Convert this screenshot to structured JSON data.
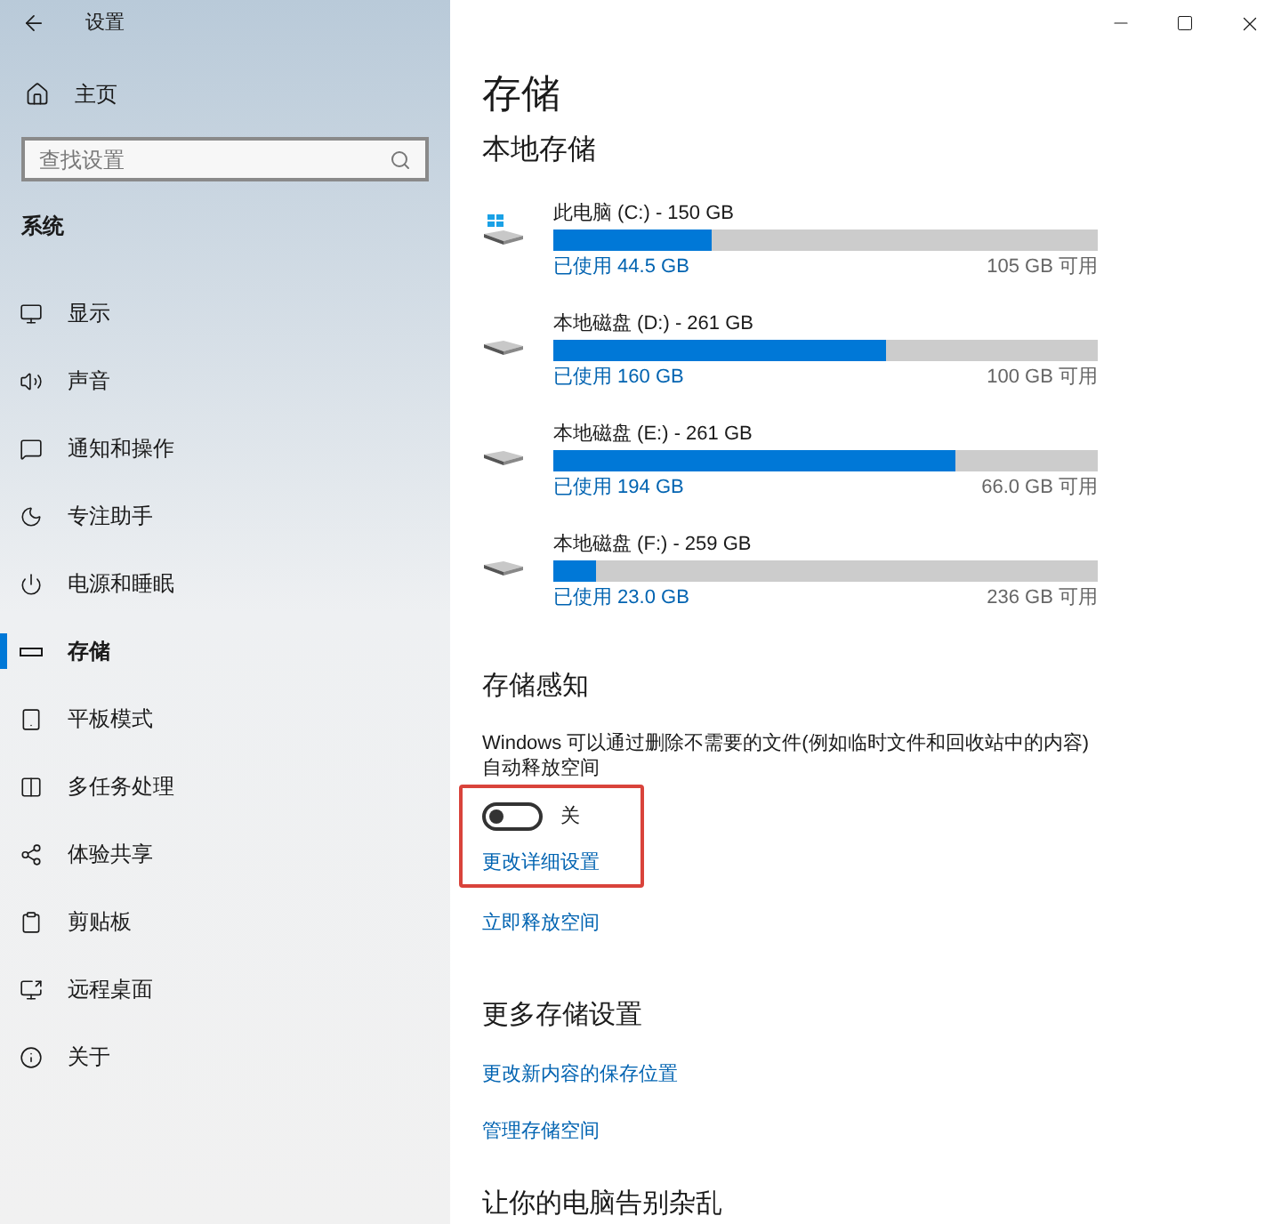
{
  "window": {
    "title": "设置"
  },
  "sidebar": {
    "home": "主页",
    "search": {
      "placeholder": "查找设置"
    },
    "section": "系统",
    "items": [
      {
        "label": "显示",
        "selected": false
      },
      {
        "label": "声音",
        "selected": false
      },
      {
        "label": "通知和操作",
        "selected": false
      },
      {
        "label": "专注助手",
        "selected": false
      },
      {
        "label": "电源和睡眠",
        "selected": false
      },
      {
        "label": "存储",
        "selected": true
      },
      {
        "label": "平板模式",
        "selected": false
      },
      {
        "label": "多任务处理",
        "selected": false
      },
      {
        "label": "体验共享",
        "selected": false
      },
      {
        "label": "剪贴板",
        "selected": false
      },
      {
        "label": "远程桌面",
        "selected": false
      },
      {
        "label": "关于",
        "selected": false
      }
    ]
  },
  "page": {
    "title": "存储",
    "local_storage": {
      "heading": "本地存储",
      "drives": [
        {
          "kind": "system",
          "name": "此电脑 (C:) - 150 GB",
          "used": "已使用 44.5 GB",
          "free": "105 GB 可用",
          "level": 0.29
        },
        {
          "kind": "disk",
          "name": "本地磁盘 (D:) - 261 GB",
          "used": "已使用 160 GB",
          "free": "100 GB 可用",
          "level": 0.61
        },
        {
          "kind": "disk",
          "name": "本地磁盘 (E:) - 261 GB",
          "used": "已使用 194 GB",
          "free": "66.0 GB 可用",
          "level": 0.74
        },
        {
          "kind": "disk",
          "name": "本地磁盘 (F:) - 259 GB",
          "used": "已使用 23.0 GB",
          "free": "236 GB 可用",
          "level": 0.08
        }
      ]
    },
    "storage_sense": {
      "heading": "存储感知",
      "description": "Windows 可以通过删除不需要的文件(例如临时文件和回收站中的内容)自动释放空间",
      "toggle": {
        "on": false,
        "label": "关"
      },
      "links": [
        "更改详细设置",
        "立即释放空间"
      ]
    },
    "more_settings": {
      "heading": "更多存储设置",
      "links": [
        "更改新内容的保存位置",
        "管理存储空间"
      ]
    },
    "cleanup": {
      "heading": "让你的电脑告别杂乱"
    }
  }
}
